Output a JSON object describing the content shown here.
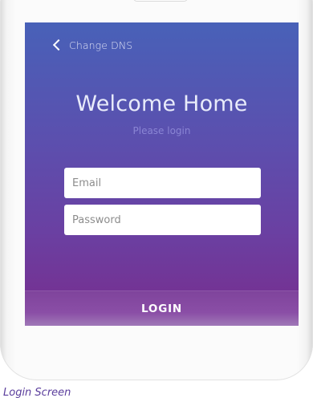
{
  "header": {
    "back_label": "Change DNS",
    "back_icon": "chevron-left-icon"
  },
  "login": {
    "title": "Welcome Home",
    "subtitle": "Please login",
    "email_placeholder": "Email",
    "password_placeholder": "Password",
    "button_label": "LOGIN"
  },
  "caption": "Login Screen",
  "colors": {
    "gradient_top": "#4861b8",
    "gradient_bottom": "#733495",
    "login_bar": "#8a4ea6",
    "caption": "#5a3d9c"
  }
}
